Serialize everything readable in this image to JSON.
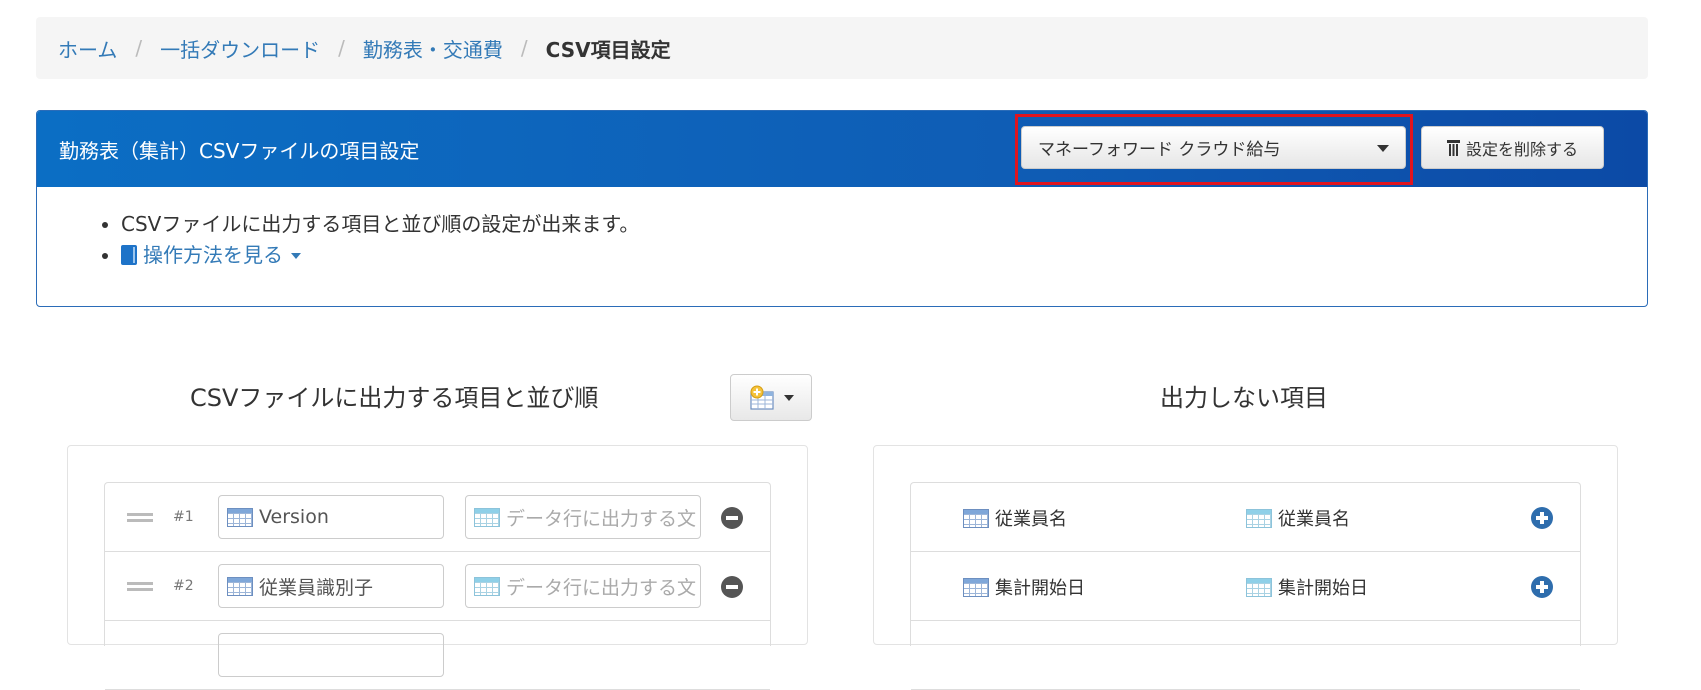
{
  "breadcrumb": {
    "items": [
      "ホーム",
      "一括ダウンロード",
      "勤務表・交通費"
    ],
    "separator": "/",
    "current": "CSV項目設定"
  },
  "panel": {
    "title": "勤務表（集計）CSVファイルの項目設定",
    "preset_select": "マネーフォワード クラウド給与",
    "delete_button": "設定を削除する",
    "bullets": {
      "description": "CSVファイルに出力する項目と並び順の設定が出来ます。",
      "help_link": "操作方法を見る"
    }
  },
  "output_section": {
    "title": "CSVファイルに出力する項目と並び順",
    "rows": [
      {
        "num": "#1",
        "value": "Version",
        "placeholder": "データ行に出力する文"
      },
      {
        "num": "#2",
        "value": "従業員識別子",
        "placeholder": "データ行に出力する文"
      }
    ]
  },
  "excluded_section": {
    "title": "出力しない項目",
    "rows": [
      {
        "field": "従業員名",
        "header": "従業員名"
      },
      {
        "field": "集計開始日",
        "header": "集計開始日"
      }
    ]
  },
  "icons": [
    "book-icon",
    "table-icon",
    "trash-icon",
    "add-column-icon",
    "minus-circle-icon",
    "plus-circle-icon"
  ],
  "colors": {
    "link": "#337ab7",
    "header_blue": "#0b6ec4",
    "highlight_red": "#e0141e"
  }
}
